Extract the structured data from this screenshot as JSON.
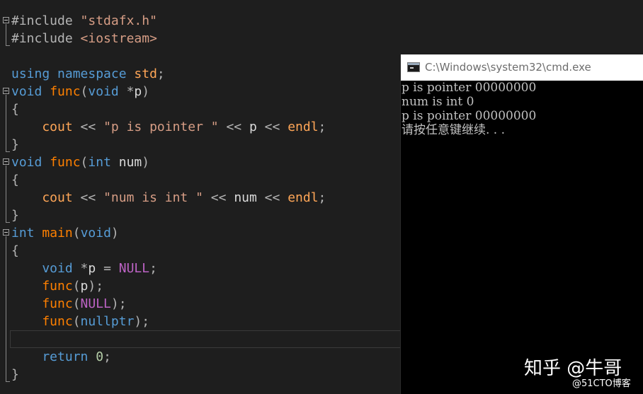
{
  "editor": {
    "lines": [
      [
        {
          "t": "#include ",
          "c": "op"
        },
        {
          "t": "\"stdafx.h\"",
          "c": "str"
        }
      ],
      [
        {
          "t": "#include ",
          "c": "op"
        },
        {
          "t": "<iostream>",
          "c": "str"
        }
      ],
      [],
      [
        {
          "t": "using ",
          "c": "kw"
        },
        {
          "t": "namespace ",
          "c": "kw"
        },
        {
          "t": "std",
          "c": "orange"
        },
        {
          "t": ";",
          "c": "op"
        }
      ],
      [
        {
          "t": "void ",
          "c": "kw"
        },
        {
          "t": "func",
          "c": "fn"
        },
        {
          "t": "(",
          "c": "op"
        },
        {
          "t": "void ",
          "c": "kw"
        },
        {
          "t": "*",
          "c": "op"
        },
        {
          "t": "p",
          "c": "id"
        },
        {
          "t": ")",
          "c": "op"
        }
      ],
      [
        {
          "t": "{",
          "c": "op"
        }
      ],
      [
        {
          "t": "    cout ",
          "c": "orange"
        },
        {
          "t": "<< ",
          "c": "op"
        },
        {
          "t": "\"p is pointer \"",
          "c": "str"
        },
        {
          "t": " << ",
          "c": "op"
        },
        {
          "t": "p",
          "c": "id"
        },
        {
          "t": " << ",
          "c": "op"
        },
        {
          "t": "endl",
          "c": "orange"
        },
        {
          "t": ";",
          "c": "op"
        }
      ],
      [
        {
          "t": "}",
          "c": "op"
        }
      ],
      [
        {
          "t": "void ",
          "c": "kw"
        },
        {
          "t": "func",
          "c": "fn"
        },
        {
          "t": "(",
          "c": "op"
        },
        {
          "t": "int ",
          "c": "kw"
        },
        {
          "t": "num",
          "c": "id"
        },
        {
          "t": ")",
          "c": "op"
        }
      ],
      [
        {
          "t": "{",
          "c": "op"
        }
      ],
      [
        {
          "t": "    cout ",
          "c": "orange"
        },
        {
          "t": "<< ",
          "c": "op"
        },
        {
          "t": "\"num is int \"",
          "c": "str"
        },
        {
          "t": " << ",
          "c": "op"
        },
        {
          "t": "num",
          "c": "id"
        },
        {
          "t": " << ",
          "c": "op"
        },
        {
          "t": "endl",
          "c": "orange"
        },
        {
          "t": ";",
          "c": "op"
        }
      ],
      [
        {
          "t": "}",
          "c": "op"
        }
      ],
      [
        {
          "t": "int ",
          "c": "kw"
        },
        {
          "t": "main",
          "c": "fn"
        },
        {
          "t": "(",
          "c": "op"
        },
        {
          "t": "void",
          "c": "kw"
        },
        {
          "t": ")",
          "c": "op"
        }
      ],
      [
        {
          "t": "{",
          "c": "op"
        }
      ],
      [
        {
          "t": "    void ",
          "c": "kw"
        },
        {
          "t": "*",
          "c": "op"
        },
        {
          "t": "p",
          "c": "id"
        },
        {
          "t": " = ",
          "c": "op"
        },
        {
          "t": "NULL",
          "c": "macro"
        },
        {
          "t": ";",
          "c": "op"
        }
      ],
      [
        {
          "t": "    func",
          "c": "fn"
        },
        {
          "t": "(",
          "c": "op"
        },
        {
          "t": "p",
          "c": "id"
        },
        {
          "t": ");",
          "c": "op"
        }
      ],
      [
        {
          "t": "    func",
          "c": "fn"
        },
        {
          "t": "(",
          "c": "op"
        },
        {
          "t": "NULL",
          "c": "macro"
        },
        {
          "t": ");",
          "c": "op"
        }
      ],
      [
        {
          "t": "    func",
          "c": "fn"
        },
        {
          "t": "(",
          "c": "op"
        },
        {
          "t": "nullptr",
          "c": "kw"
        },
        {
          "t": ");",
          "c": "op"
        }
      ],
      [],
      [
        {
          "t": "    return ",
          "c": "kw"
        },
        {
          "t": "0",
          "c": "num"
        },
        {
          "t": ";",
          "c": "op"
        }
      ],
      [
        {
          "t": "}",
          "c": "op"
        }
      ]
    ]
  },
  "cmd": {
    "title": "C:\\Windows\\system32\\cmd.exe",
    "output": [
      "p is pointer 00000000",
      "num is int 0",
      "p is pointer 00000000",
      "请按任意键继续. . ."
    ]
  },
  "watermark": {
    "main": "知乎 @牛哥",
    "sub": "@51CTO博客"
  },
  "colors": {
    "editor_bg": "#1e1e1e",
    "keyword": "#569cd6",
    "string": "#d69d85",
    "function": "#ff8000",
    "macro": "#bd63c5",
    "cmd_bg": "#000000",
    "cmd_text": "#c0c0c0"
  },
  "icons": [
    "fold-collapse-icon",
    "cmd-app-icon"
  ]
}
